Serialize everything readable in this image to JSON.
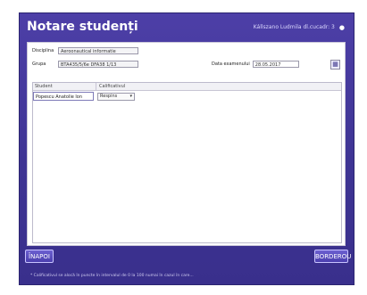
{
  "app": {
    "title": "Notare studenți"
  },
  "user": {
    "text": "Kállszano Ludmila dl.cucadr: 3",
    "icon": "user-icon"
  },
  "form": {
    "discipline_label": "Disciplina",
    "discipline_value": "Aeroonautical informatie",
    "group_label": "Grupa",
    "group_value": "BTA435/5/6e DFA38 1/13",
    "date_label": "Data examenului",
    "date_value": "28.05.2017",
    "calendar_icon": "calendar-icon"
  },
  "grid": {
    "columns": [
      "Student",
      "Calificativul"
    ],
    "rows": [
      {
        "student": "Popescu Anatolie lon",
        "grade": "Respins"
      }
    ]
  },
  "buttons": {
    "back": "ÎNAPOI",
    "borderou": "BORDEROU"
  },
  "footnote": "* Calificativul se alocă în puncte în intervalul de 0 la 100 numai în cazul în care..."
}
